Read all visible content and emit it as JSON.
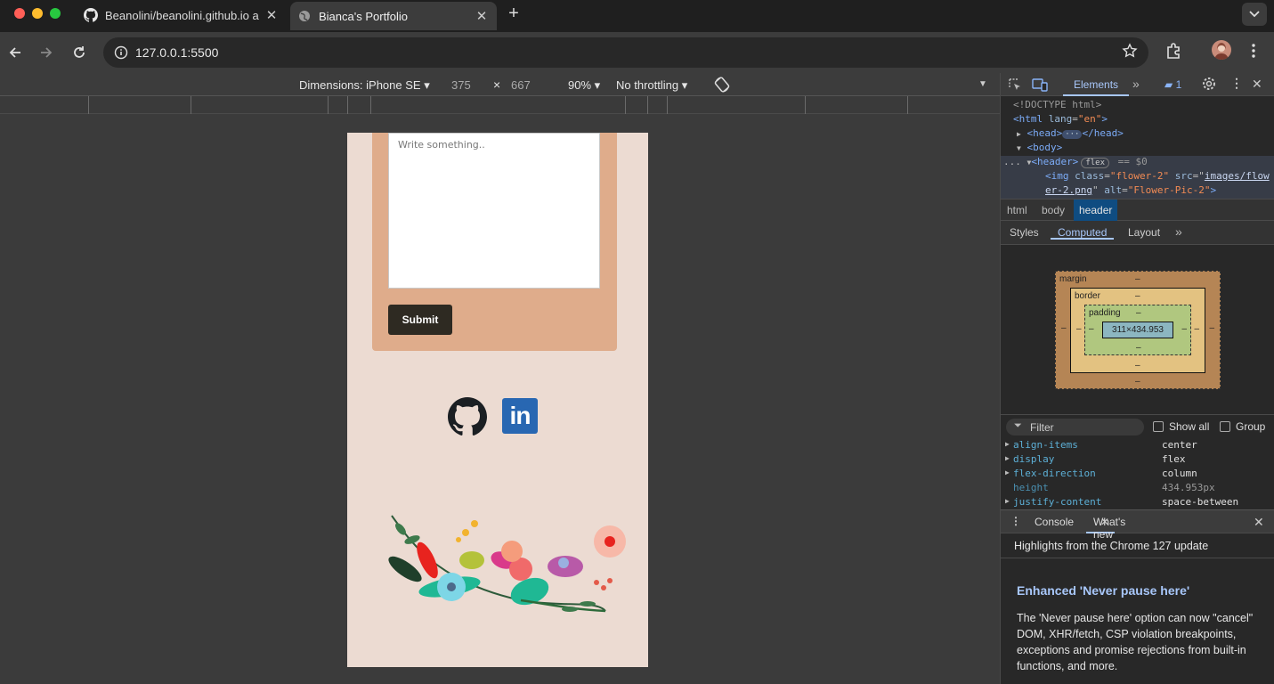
{
  "browser": {
    "tabs": [
      {
        "title": "Beanolini/beanolini.github.io a",
        "active": false
      },
      {
        "title": "Bianca's Portfolio",
        "active": true
      }
    ],
    "url": "127.0.0.1:5500",
    "new_tab": "+"
  },
  "device_toolbar": {
    "dimensions_label": "Dimensions: iPhone SE",
    "width": "375",
    "times": "×",
    "height": "667",
    "zoom": "90%",
    "throttling": "No throttling"
  },
  "page": {
    "textarea_placeholder": "Write something..",
    "submit_label": "Submit",
    "linkedin_text": "in",
    "colors": {
      "background": "#ecdbd2",
      "form_card": "#dfac8b",
      "submit": "#2e2a22"
    }
  },
  "devtools": {
    "main_tab": "Elements",
    "issues_count": "1",
    "code": {
      "doctype": "<!DOCTYPE html>",
      "html_open": "<html",
      "html_lang_attr": "lang",
      "html_lang_val": "\"en\"",
      "head": "<head>",
      "head_close": "</head>",
      "body": "<body>",
      "header": "<header>",
      "flex_badge": "flex",
      "dollar0": "== $0",
      "img_tag": "<img",
      "img_class_attr": "class",
      "img_class_val": "\"flower-2\"",
      "img_src_attr": "src",
      "img_src_val_1": "images/flow",
      "img_src_val_2": "er-2.png",
      "img_alt_attr": "alt",
      "img_alt_val": "\"Flower-Pic-2\"",
      "ellipsis": "..."
    },
    "breadcrumbs": [
      "html",
      "body",
      "header"
    ],
    "subtabs": [
      "Styles",
      "Computed",
      "Layout"
    ],
    "box_model": {
      "margin": "margin",
      "border": "border",
      "padding": "padding",
      "content": "311×434.953",
      "dash": "–"
    },
    "filter": {
      "placeholder": "Filter",
      "show_all": "Show all",
      "group": "Group"
    },
    "properties": [
      {
        "name": "align-items",
        "value": "center"
      },
      {
        "name": "display",
        "value": "flex"
      },
      {
        "name": "flex-direction",
        "value": "column"
      },
      {
        "name": "height",
        "value": "434.953px"
      },
      {
        "name": "justify-content",
        "value": "space-between"
      }
    ],
    "drawer": {
      "console": "Console",
      "whats_new": "What's new"
    },
    "highlights": "Highlights from the Chrome 127 update",
    "feature_title": "Enhanced 'Never pause here'",
    "feature_text": "The 'Never pause here' option can now \"cancel\" DOM, XHR/fetch, CSP violation breakpoints, exceptions and promise rejections from built-in functions, and more."
  }
}
